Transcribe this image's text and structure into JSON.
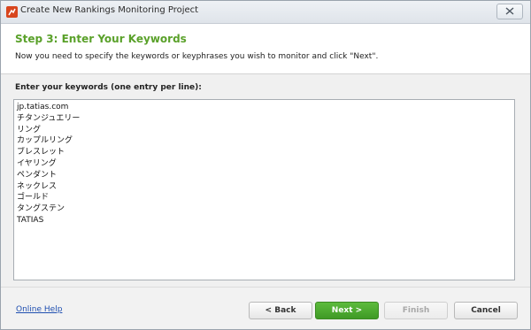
{
  "window": {
    "title": "Create New Rankings Monitoring Project"
  },
  "header": {
    "step_title": "Step 3: Enter Your Keywords",
    "description": "Now you need to specify the keywords or keyphrases you wish to monitor and click \"Next\"."
  },
  "keywords": {
    "label": "Enter your keywords (one entry per line):",
    "lines": [
      "jp.tatias.com",
      "チタンジュエリー",
      "リング",
      "カップルリング",
      "ブレスレット",
      "イヤリング",
      "ペンダント",
      "ネックレス",
      "ゴールド",
      "タングステン",
      "TATIAS"
    ]
  },
  "footer": {
    "help_link": "Online Help",
    "back_label": "< Back",
    "next_label": "Next >",
    "finish_label": "Finish",
    "cancel_label": "Cancel"
  },
  "colors": {
    "step_title": "#5aa12a",
    "next_button": "#4aa82f",
    "link": "#1f4fb0"
  },
  "icons": {
    "app": "app-logo-icon",
    "close": "close-icon"
  }
}
